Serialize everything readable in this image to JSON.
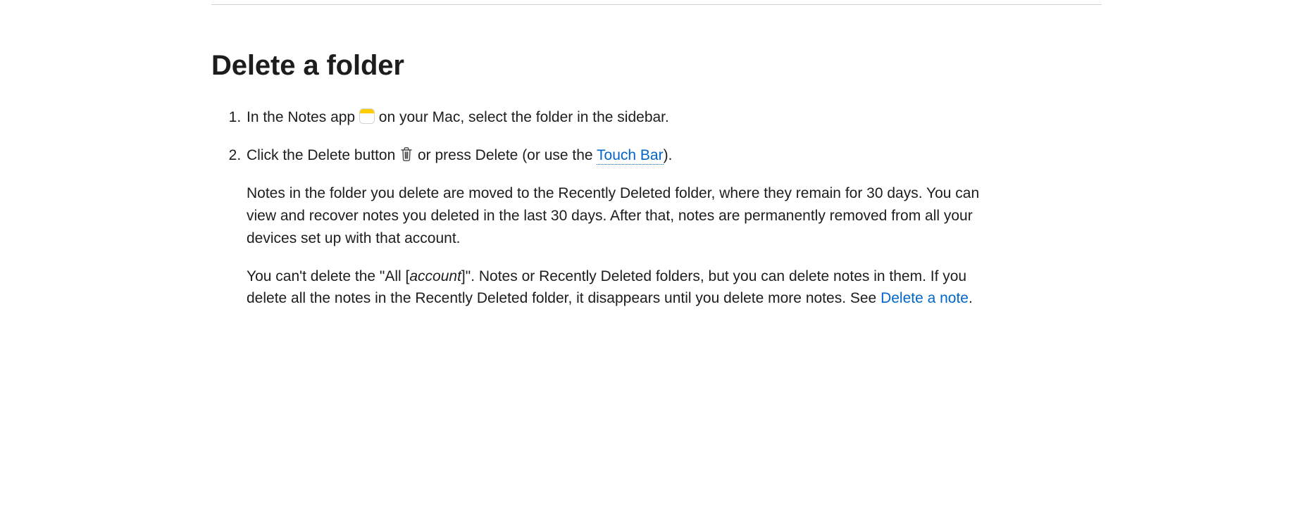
{
  "title": "Delete a folder",
  "steps": [
    {
      "parts": {
        "before": "In the Notes app ",
        "after": " on your Mac, select the folder in the sidebar."
      }
    },
    {
      "parts": {
        "before": "Click the Delete button ",
        "mid": " or press Delete (or use the ",
        "link": "Touch Bar",
        "after": ")."
      },
      "para1": "Notes in the folder you delete are moved to the Recently Deleted folder, where they remain for 30 days. You can view and recover notes you deleted in the last 30 days. After that, notes are permanently removed from all your devices set up with that account.",
      "para2": {
        "a": "You can't delete the \"All [",
        "italic": "account",
        "b": "]\". Notes or Recently Deleted folders, but you can delete notes in them. If you delete all the notes in the Recently Deleted folder, it disappears until you delete more notes. See ",
        "link": "Delete a note",
        "c": "."
      }
    }
  ]
}
